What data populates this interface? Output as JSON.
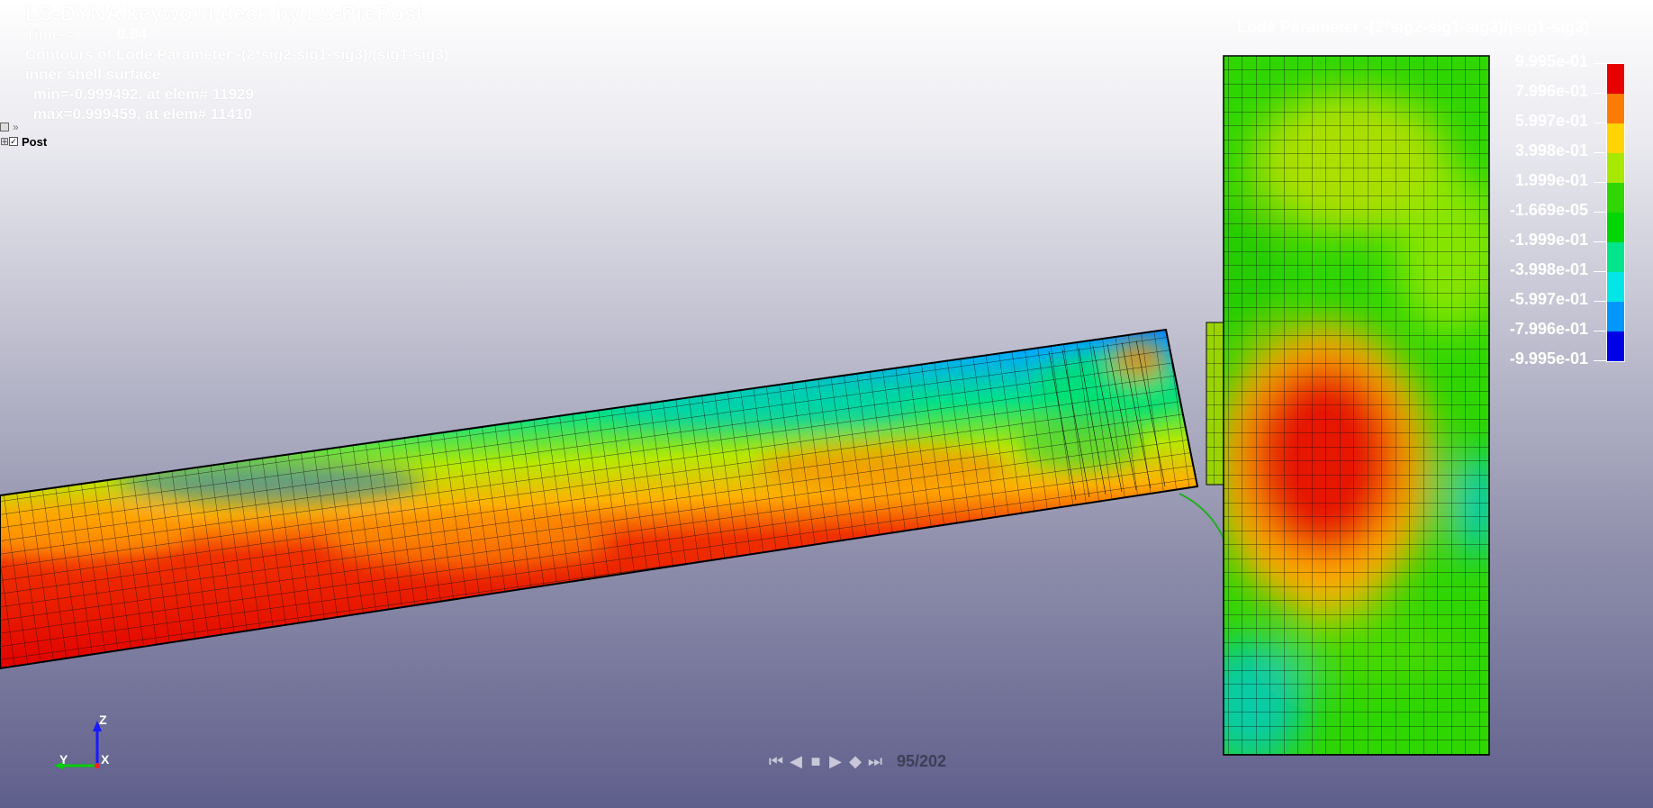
{
  "header": {
    "deck_title": "LS-DYNA keyword deck by LS-PrePost",
    "time_label": "Time =",
    "time_value": "0.94",
    "contour_title": "Contours of Lode Parameter -(2*sig2-sig1-sig3)/(sig1-sig3)",
    "surface_label": "inner shell surface",
    "min_line": " min=-0.999492, at elem# 11929",
    "max_line": " max=0.999459, at elem# 11410"
  },
  "tree": {
    "item_label": "Post"
  },
  "legend": {
    "title": "Lode Parameter -(2*sig2-sig1-sig3)/(sig1-sig3)",
    "labels": [
      "9.995e-01",
      "7.996e-01",
      "5.997e-01",
      "3.998e-01",
      "1.999e-01",
      "-1.669e-05",
      "-1.999e-01",
      "-3.998e-01",
      "-5.997e-01",
      "-7.996e-01",
      "-9.995e-01"
    ],
    "colors": [
      "#e60000",
      "#ff7a00",
      "#ffd400",
      "#a8e800",
      "#2fd600",
      "#00d600",
      "#00e48c",
      "#00e6e6",
      "#0096ff",
      "#0000e6"
    ]
  },
  "axis_triad": {
    "z_label": "Z",
    "y_label": "Y",
    "x_label": "X",
    "colors": {
      "z": "#1a1aff",
      "y": "#00cc00",
      "x": "#ff2020"
    }
  },
  "playback": {
    "buttons": [
      "first-frame-icon",
      "step-back-icon",
      "stop-icon",
      "play-icon",
      "step-both-icon",
      "last-frame-icon"
    ],
    "frame_counter": "95/202"
  }
}
